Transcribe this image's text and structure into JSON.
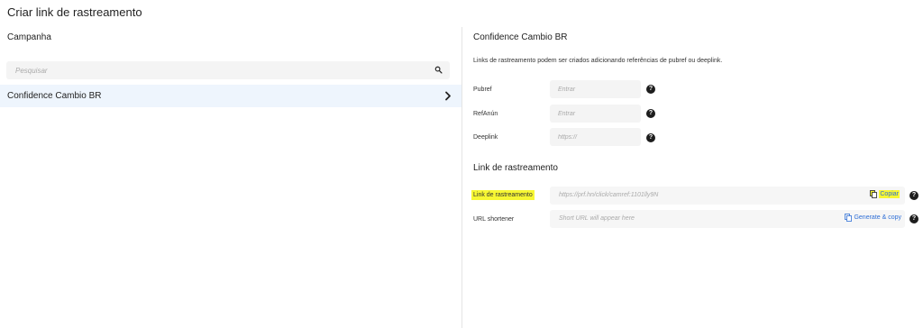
{
  "page": {
    "title": "Criar link de rastreamento"
  },
  "left": {
    "section_label": "Campanha",
    "search_placeholder": "Pesquisar",
    "campaign": "Confidence Cambio BR"
  },
  "right": {
    "heading": "Confidence Cambio BR",
    "description": "Links de rastreamento podem ser criados adicionando referências de pubref ou deeplink.",
    "fields": [
      {
        "label": "Pubref",
        "placeholder": "Entrar"
      },
      {
        "label": "RefAnún",
        "placeholder": "Entrar"
      },
      {
        "label": "Deeplink",
        "placeholder": "https://"
      }
    ],
    "tracking": {
      "heading": "Link de rastreamento",
      "link_label": "Link de rastreamento",
      "link_value": "https://prf.hn/click/camref:1101lly9N",
      "copy_label": "Copiar",
      "shortener_label": "URL shortener",
      "shortener_placeholder": "Short URL will appear here",
      "generate_label": "Generate & copy"
    }
  },
  "colors": {
    "highlight": "#f7f733",
    "link_blue": "#2f6fd6",
    "selected_row": "#eef5fd"
  },
  "icons": {
    "search": "search-icon",
    "chevron": "chevron-right-icon",
    "help": "help-icon",
    "copy": "copy-icon"
  }
}
